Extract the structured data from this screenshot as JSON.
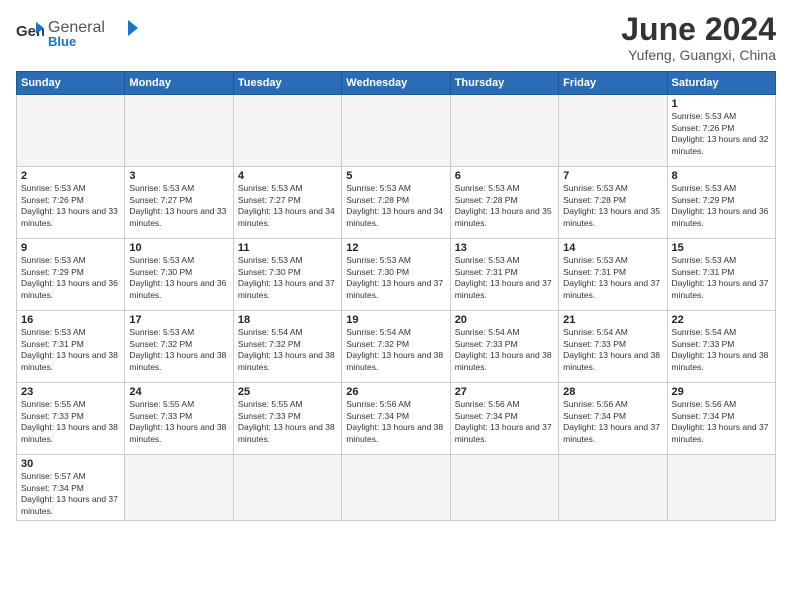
{
  "logo": {
    "text_general": "General",
    "text_blue": "Blue"
  },
  "title": "June 2024",
  "subtitle": "Yufeng, Guangxi, China",
  "weekdays": [
    "Sunday",
    "Monday",
    "Tuesday",
    "Wednesday",
    "Thursday",
    "Friday",
    "Saturday"
  ],
  "weeks": [
    [
      {
        "day": "",
        "info": ""
      },
      {
        "day": "",
        "info": ""
      },
      {
        "day": "",
        "info": ""
      },
      {
        "day": "",
        "info": ""
      },
      {
        "day": "",
        "info": ""
      },
      {
        "day": "",
        "info": ""
      },
      {
        "day": "1",
        "info": "Sunrise: 5:53 AM\nSunset: 7:26 PM\nDaylight: 13 hours and 32 minutes."
      }
    ],
    [
      {
        "day": "2",
        "info": "Sunrise: 5:53 AM\nSunset: 7:26 PM\nDaylight: 13 hours and 33 minutes."
      },
      {
        "day": "3",
        "info": "Sunrise: 5:53 AM\nSunset: 7:27 PM\nDaylight: 13 hours and 33 minutes."
      },
      {
        "day": "4",
        "info": "Sunrise: 5:53 AM\nSunset: 7:27 PM\nDaylight: 13 hours and 34 minutes."
      },
      {
        "day": "5",
        "info": "Sunrise: 5:53 AM\nSunset: 7:28 PM\nDaylight: 13 hours and 34 minutes."
      },
      {
        "day": "6",
        "info": "Sunrise: 5:53 AM\nSunset: 7:28 PM\nDaylight: 13 hours and 35 minutes."
      },
      {
        "day": "7",
        "info": "Sunrise: 5:53 AM\nSunset: 7:28 PM\nDaylight: 13 hours and 35 minutes."
      },
      {
        "day": "8",
        "info": "Sunrise: 5:53 AM\nSunset: 7:29 PM\nDaylight: 13 hours and 36 minutes."
      }
    ],
    [
      {
        "day": "9",
        "info": "Sunrise: 5:53 AM\nSunset: 7:29 PM\nDaylight: 13 hours and 36 minutes."
      },
      {
        "day": "10",
        "info": "Sunrise: 5:53 AM\nSunset: 7:30 PM\nDaylight: 13 hours and 36 minutes."
      },
      {
        "day": "11",
        "info": "Sunrise: 5:53 AM\nSunset: 7:30 PM\nDaylight: 13 hours and 37 minutes."
      },
      {
        "day": "12",
        "info": "Sunrise: 5:53 AM\nSunset: 7:30 PM\nDaylight: 13 hours and 37 minutes."
      },
      {
        "day": "13",
        "info": "Sunrise: 5:53 AM\nSunset: 7:31 PM\nDaylight: 13 hours and 37 minutes."
      },
      {
        "day": "14",
        "info": "Sunrise: 5:53 AM\nSunset: 7:31 PM\nDaylight: 13 hours and 37 minutes."
      },
      {
        "day": "15",
        "info": "Sunrise: 5:53 AM\nSunset: 7:31 PM\nDaylight: 13 hours and 37 minutes."
      }
    ],
    [
      {
        "day": "16",
        "info": "Sunrise: 5:53 AM\nSunset: 7:31 PM\nDaylight: 13 hours and 38 minutes."
      },
      {
        "day": "17",
        "info": "Sunrise: 5:53 AM\nSunset: 7:32 PM\nDaylight: 13 hours and 38 minutes."
      },
      {
        "day": "18",
        "info": "Sunrise: 5:54 AM\nSunset: 7:32 PM\nDaylight: 13 hours and 38 minutes."
      },
      {
        "day": "19",
        "info": "Sunrise: 5:54 AM\nSunset: 7:32 PM\nDaylight: 13 hours and 38 minutes."
      },
      {
        "day": "20",
        "info": "Sunrise: 5:54 AM\nSunset: 7:33 PM\nDaylight: 13 hours and 38 minutes."
      },
      {
        "day": "21",
        "info": "Sunrise: 5:54 AM\nSunset: 7:33 PM\nDaylight: 13 hours and 38 minutes."
      },
      {
        "day": "22",
        "info": "Sunrise: 5:54 AM\nSunset: 7:33 PM\nDaylight: 13 hours and 38 minutes."
      }
    ],
    [
      {
        "day": "23",
        "info": "Sunrise: 5:55 AM\nSunset: 7:33 PM\nDaylight: 13 hours and 38 minutes."
      },
      {
        "day": "24",
        "info": "Sunrise: 5:55 AM\nSunset: 7:33 PM\nDaylight: 13 hours and 38 minutes."
      },
      {
        "day": "25",
        "info": "Sunrise: 5:55 AM\nSunset: 7:33 PM\nDaylight: 13 hours and 38 minutes."
      },
      {
        "day": "26",
        "info": "Sunrise: 5:56 AM\nSunset: 7:34 PM\nDaylight: 13 hours and 38 minutes."
      },
      {
        "day": "27",
        "info": "Sunrise: 5:56 AM\nSunset: 7:34 PM\nDaylight: 13 hours and 37 minutes."
      },
      {
        "day": "28",
        "info": "Sunrise: 5:56 AM\nSunset: 7:34 PM\nDaylight: 13 hours and 37 minutes."
      },
      {
        "day": "29",
        "info": "Sunrise: 5:56 AM\nSunset: 7:34 PM\nDaylight: 13 hours and 37 minutes."
      }
    ],
    [
      {
        "day": "30",
        "info": "Sunrise: 5:57 AM\nSunset: 7:34 PM\nDaylight: 13 hours and 37 minutes."
      },
      {
        "day": "",
        "info": ""
      },
      {
        "day": "",
        "info": ""
      },
      {
        "day": "",
        "info": ""
      },
      {
        "day": "",
        "info": ""
      },
      {
        "day": "",
        "info": ""
      },
      {
        "day": "",
        "info": ""
      }
    ]
  ]
}
